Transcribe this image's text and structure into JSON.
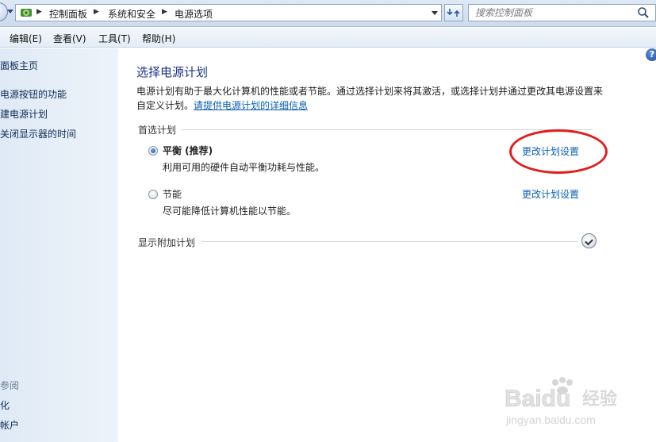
{
  "address_bar": {
    "breadcrumbs": [
      "控制面板",
      "系统和安全",
      "电源选项"
    ]
  },
  "search": {
    "placeholder": "搜索控制面板"
  },
  "menu": {
    "items": [
      "编辑(E)",
      "查看(V)",
      "工具(T)",
      "帮助(H)"
    ]
  },
  "sidebar": {
    "items": [
      "面板主页",
      "电源按钮的功能",
      "建电源计划",
      "关闭显示器的时间"
    ],
    "see_also_header": "参阅",
    "see_also_items": [
      "化",
      "帐户"
    ]
  },
  "main": {
    "title": "选择电源计划",
    "description": "电源计划有助于最大化计算机的性能或者节能。通过选择计划来将其激活，或选择计划并通过更改其电源设置来自定义计划。",
    "description_link": "请提供电源计划的详细信息",
    "preferred_section": "首选计划",
    "plans": [
      {
        "name": "平衡 (推荐)",
        "description": "利用可用的硬件自动平衡功耗与性能。",
        "link": "更改计划设置",
        "selected": true
      },
      {
        "name": "节能",
        "description": "尽可能降低计算机性能以节能。",
        "link": "更改计划设置",
        "selected": false
      }
    ],
    "additional_section": "显示附加计划"
  },
  "help": {
    "label": "?"
  },
  "watermark": {
    "brand": "Baidu",
    "subtitle": "经验",
    "url": "jingyan.baidu.com"
  },
  "colors": {
    "link": "#0b5fb3",
    "title": "#1e3287",
    "highlight": "#e21d1d"
  },
  "icons": [
    "back-icon",
    "control-panel-icon",
    "refresh-icon",
    "search-icon",
    "help-icon",
    "expand-icon"
  ]
}
